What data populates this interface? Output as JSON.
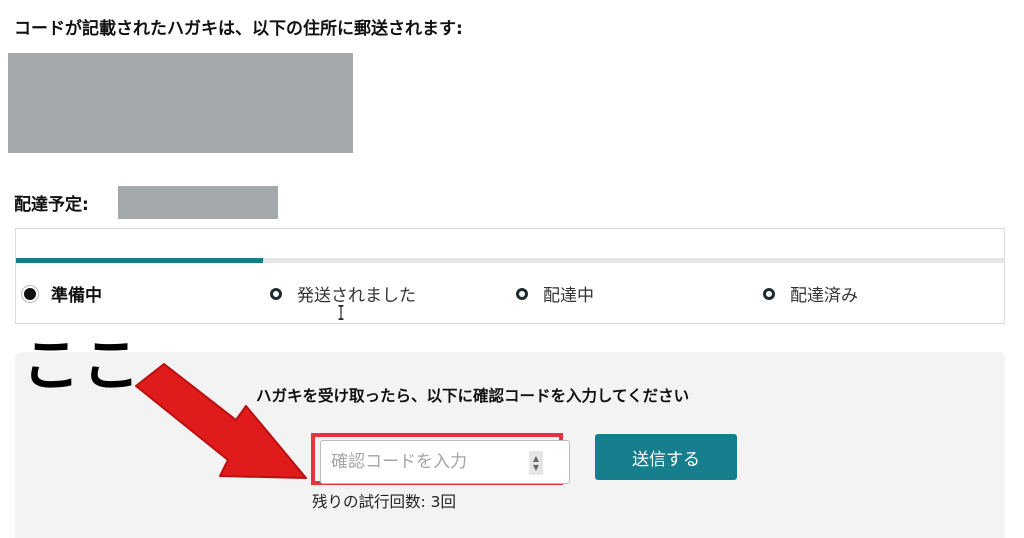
{
  "address": {
    "heading": "コードが記載されたハガキは、以下の住所に郵送されます:"
  },
  "delivery": {
    "label": "配達予定:"
  },
  "tracker": {
    "progress": 0.25,
    "steps": [
      {
        "label": "準備中",
        "active": true
      },
      {
        "label": "発送されました",
        "active": false
      },
      {
        "label": "配達中",
        "active": false
      },
      {
        "label": "配達済み",
        "active": false
      }
    ]
  },
  "verify": {
    "instruction": "ハガキを受け取ったら、以下に確認コードを入力してください",
    "input_placeholder": "確認コードを入力",
    "submit_label": "送信する",
    "attempts_text": "残りの試行回数: 3回"
  },
  "annotation": {
    "text": "ここ",
    "arrow_color": "#e01b1b",
    "highlight_color": "#e8333c"
  },
  "colors": {
    "accent": "#167e8c",
    "redaction": "#a4a9ab"
  },
  "icons": {
    "ibeam_cursor": "text-cursor-icon"
  }
}
